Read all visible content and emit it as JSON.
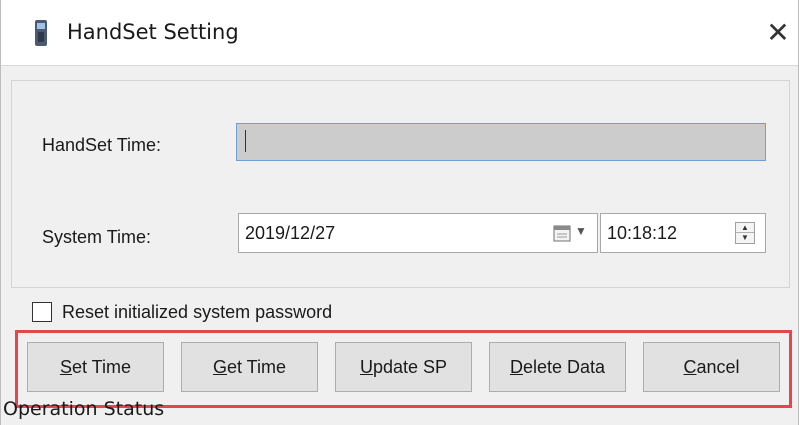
{
  "window": {
    "title": "HandSet Setting",
    "app_icon": "handset-icon",
    "close_glyph": "✕"
  },
  "form": {
    "handset_time_label": "HandSet Time:",
    "handset_time_value": "",
    "system_time_label": "System Time:",
    "system_date_value": "2019/12/27",
    "system_time_value": "10:18:12"
  },
  "options": {
    "reset_password_label": "Reset initialized system password",
    "reset_password_checked": false
  },
  "buttons": {
    "set_time": {
      "mnemonic": "S",
      "rest": "et Time"
    },
    "get_time": {
      "mnemonic": "G",
      "rest": "et Time"
    },
    "update_sp": {
      "mnemonic": "U",
      "rest": "pdate SP"
    },
    "delete_data": {
      "mnemonic": "D",
      "rest": "elete Data"
    },
    "cancel": {
      "mnemonic": "C",
      "rest": "ancel"
    }
  },
  "status": {
    "label": "Operation Status"
  },
  "colors": {
    "highlight": "#e0484f",
    "field_focus_border": "#6f9fd5"
  }
}
